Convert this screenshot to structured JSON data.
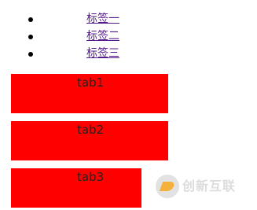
{
  "tabs": [
    {
      "link_label": "标签一"
    },
    {
      "link_label": "标签二"
    },
    {
      "link_label": "标签三"
    }
  ],
  "panels": [
    {
      "label": "tab1"
    },
    {
      "label": "tab2"
    },
    {
      "label": "tab3"
    }
  ],
  "watermark": {
    "text": "创新互联"
  },
  "colors": {
    "panel_background": "#ff0000",
    "link": "#551a8b",
    "bullet": "#000000",
    "watermark_accent": "#f4b23c"
  }
}
